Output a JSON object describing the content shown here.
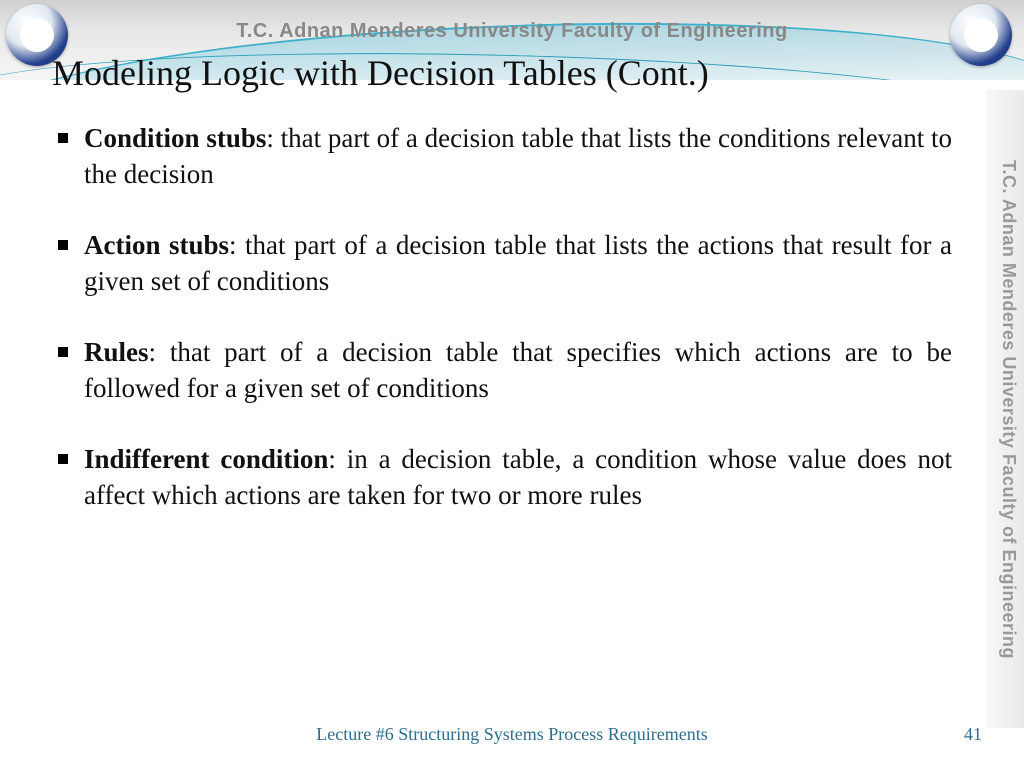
{
  "header": {
    "banner": "T.C.    Adnan Menderes University    Faculty of Engineering",
    "side_banner": "T.C.   Adnan Menderes University   Faculty of Engineering"
  },
  "slide": {
    "title": "Modeling Logic with Decision Tables (Cont.)",
    "bullets": [
      {
        "term": "Condition stubs",
        "desc": ": that part of a decision table that lists the conditions relevant to the decision"
      },
      {
        "term": "Action stubs",
        "desc": ": that part of a decision table that lists the actions that result for a given set of conditions"
      },
      {
        "term": "Rules",
        "desc": ": that part of a decision table that  specifies which actions are to be followed for a given set of conditions"
      },
      {
        "term": "Indifferent condition",
        "desc": ": in a decision table, a condition whose value does not affect which actions are taken for two or more rules"
      }
    ]
  },
  "footer": {
    "lecture": "Lecture #6 Structuring Systems Process Requirements",
    "page": "41"
  }
}
